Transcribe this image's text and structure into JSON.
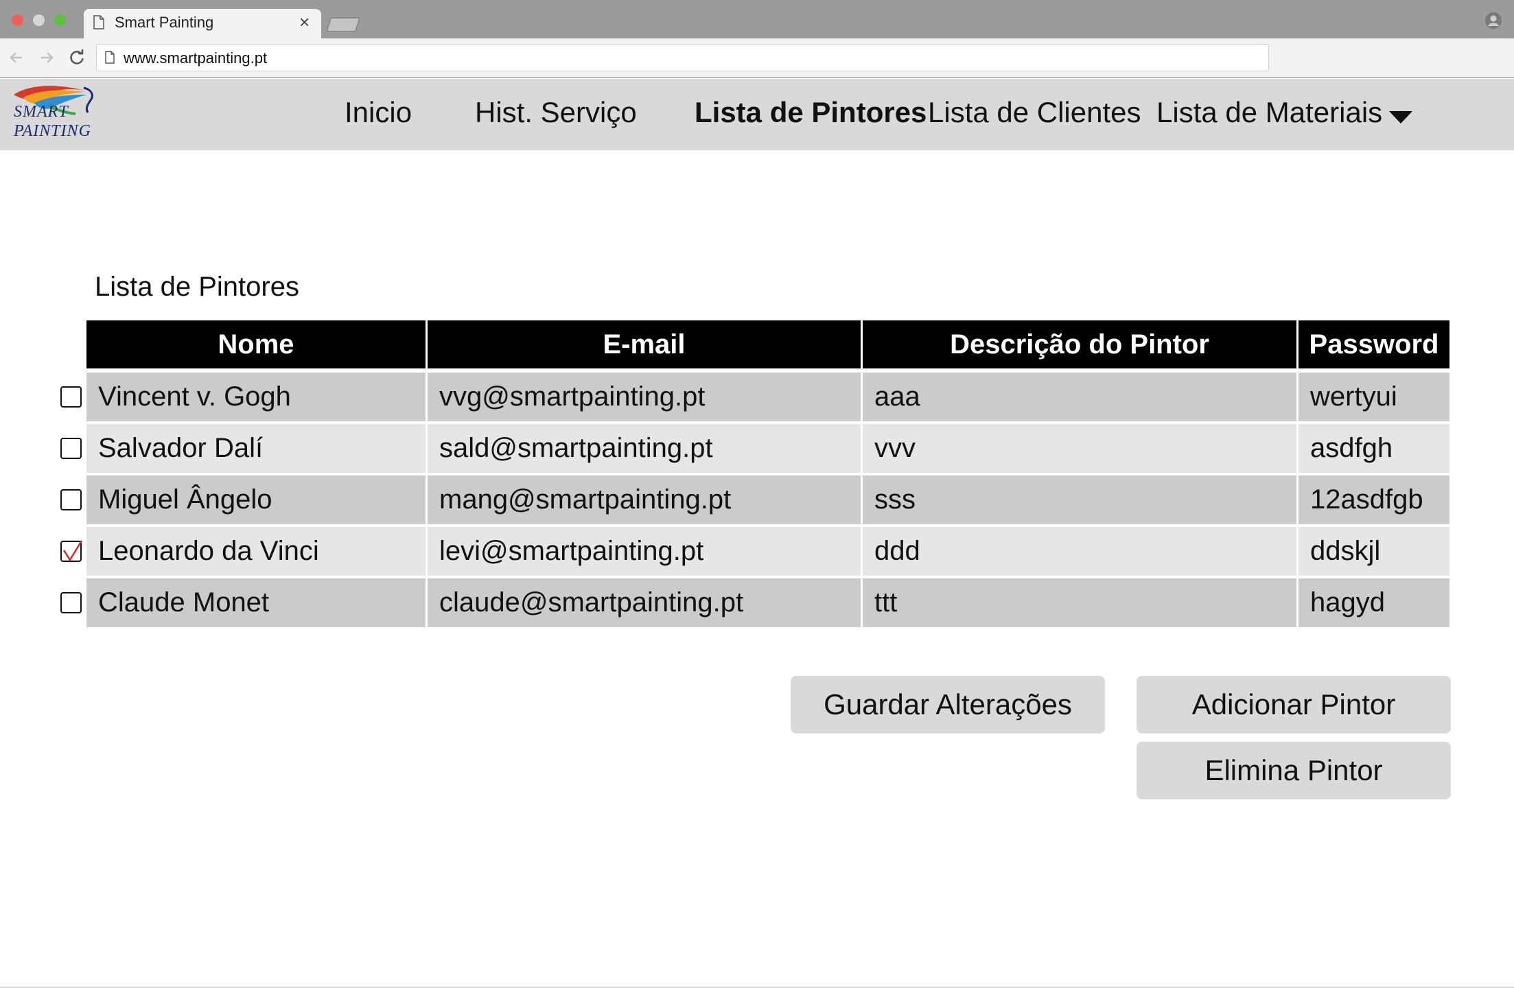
{
  "browser": {
    "tab_title": "Smart Painting",
    "tab_close": "×",
    "url": "www.smartpainting.pt"
  },
  "site": {
    "logo": {
      "line1": "SMART",
      "line2": "PAINTING"
    },
    "nav": {
      "inicio": "Inicio",
      "hist_servico": "Hist. Serviço",
      "lista_pintores": "Lista de Pintores",
      "lista_clientes": "Lista de Clientes",
      "lista_materiais": "Lista de Materiais"
    },
    "active_nav": "Lista de Pintores"
  },
  "page": {
    "title": "Lista de Pintores",
    "table": {
      "headers": [
        "Nome",
        "E-mail",
        "Descrição do Pintor",
        "Password"
      ],
      "rows": [
        {
          "checked": false,
          "cells": [
            "Vincent v. Gogh",
            "vvg@smartpainting.pt",
            "aaa",
            "wertyui"
          ]
        },
        {
          "checked": false,
          "cells": [
            "Salvador Dalí",
            "sald@smartpainting.pt",
            "vvv",
            "asdfgh"
          ]
        },
        {
          "checked": false,
          "cells": [
            "Miguel Ângelo",
            "mang@smartpainting.pt",
            "sss",
            "12asdfgb"
          ]
        },
        {
          "checked": true,
          "cells": [
            "Leonardo da Vinci",
            "levi@smartpainting.pt",
            "ddd",
            "ddskjl"
          ]
        },
        {
          "checked": false,
          "cells": [
            "Claude Monet",
            "claude@smartpainting.pt",
            "ttt",
            "hagyd"
          ]
        }
      ]
    },
    "buttons": {
      "save": "Guardar Alterações",
      "add": "Adicionar Pintor",
      "delete": "Elimina Pintor"
    }
  },
  "colors": {
    "header_bg": "#000000",
    "row_odd": "#cbcbcb",
    "row_even": "#e6e6e6",
    "navbar_bg": "#d9d9d9",
    "checkmark": "#d9252b"
  }
}
